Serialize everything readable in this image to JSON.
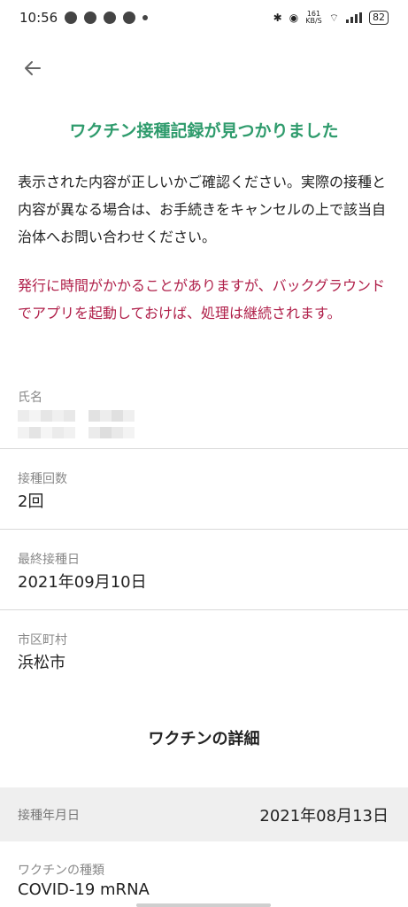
{
  "status_bar": {
    "time": "10:56",
    "net_speed": "161\nKB/S",
    "battery": "82"
  },
  "header": {
    "title": "ワクチン接種記録が見つかりました"
  },
  "description": "表示された内容が正しいかご確認ください。実際の接種と内容が異なる場合は、お手続きをキャンセルの上で該当自治体へお問い合わせください。",
  "warning": "発行に時間がかかることがありますが、バックグラウンドでアプリを起動しておけば、処理は継続されます。",
  "fields": {
    "name_label": "氏名",
    "dose_count_label": "接種回数",
    "dose_count_value": "2回",
    "last_date_label": "最終接種日",
    "last_date_value": "2021年09月10日",
    "municipality_label": "市区町村",
    "municipality_value": "浜松市"
  },
  "details": {
    "section_title": "ワクチンの詳細",
    "date_label": "接種年月日",
    "date_value": "2021年08月13日",
    "vaccine_type_label": "ワクチンの種類",
    "vaccine_type_value": "COVID-19 mRNA"
  }
}
